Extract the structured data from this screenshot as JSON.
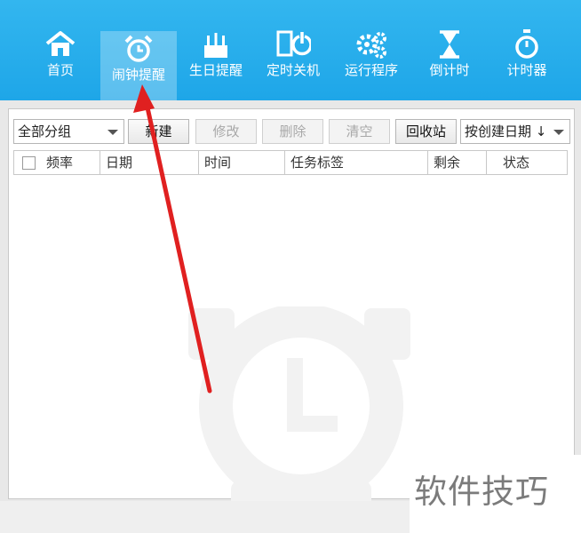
{
  "nav": {
    "items": [
      {
        "label": "首页",
        "icon": "home-icon"
      },
      {
        "label": "闹钟提醒",
        "icon": "alarm-clock-icon",
        "active": true
      },
      {
        "label": "生日提醒",
        "icon": "birthday-cake-icon"
      },
      {
        "label": "定时关机",
        "icon": "power-off-icon"
      },
      {
        "label": "运行程序",
        "icon": "gears-icon"
      },
      {
        "label": "倒计时",
        "icon": "hourglass-icon"
      },
      {
        "label": "计时器",
        "icon": "stopwatch-icon"
      }
    ]
  },
  "toolbar": {
    "group_select": "全部分组",
    "new_label": "新建",
    "edit_label": "修改",
    "delete_label": "删除",
    "clear_label": "清空",
    "recycle_label": "回收站",
    "sort_select": "按创建日期 ↓"
  },
  "table": {
    "columns": [
      "频率",
      "日期",
      "时间",
      "任务标签",
      "剩余",
      "状态"
    ]
  },
  "watermark_text": "软件技巧",
  "colors": {
    "topbar": "#1ea6e8",
    "annotation_arrow": "#e02020"
  }
}
